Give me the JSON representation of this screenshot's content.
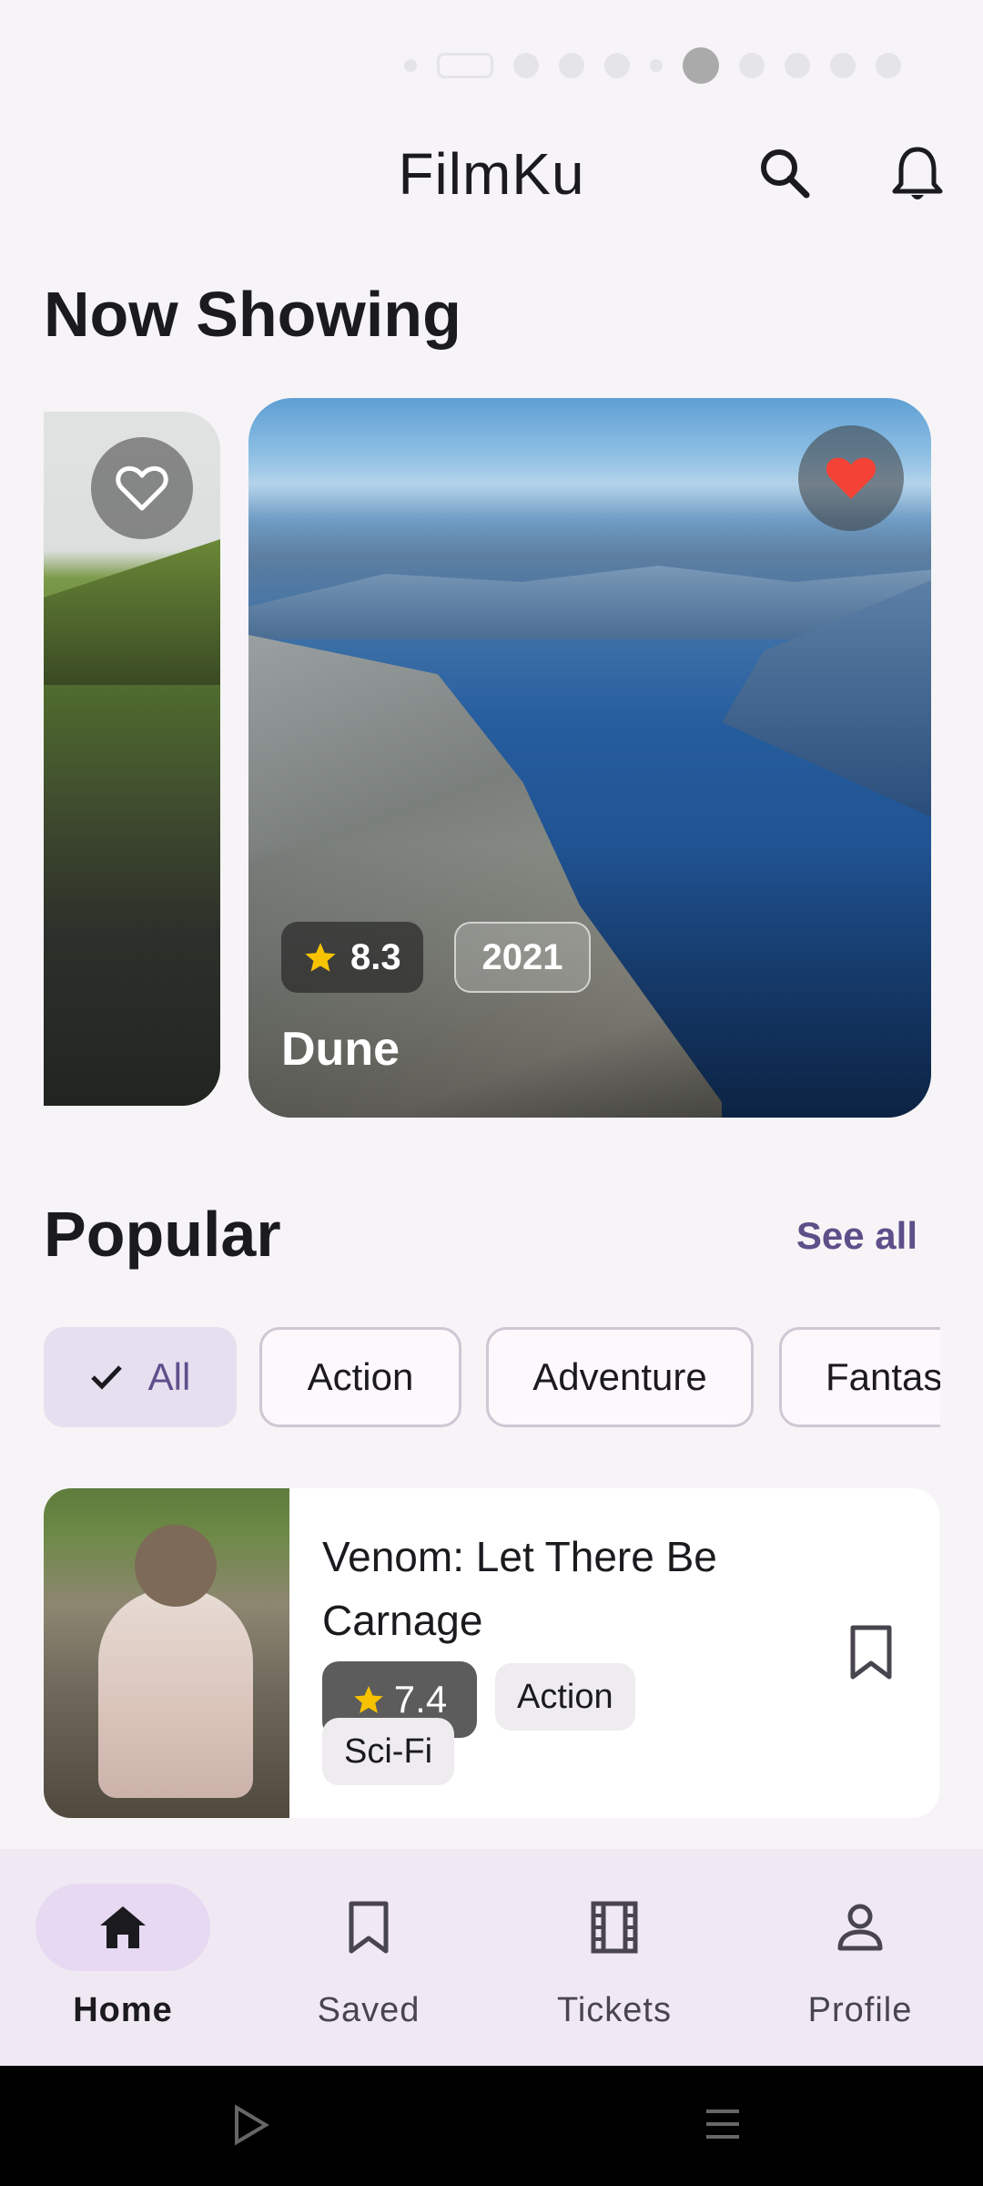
{
  "app": {
    "title": "FilmKu"
  },
  "sections": {
    "now_showing": "Now Showing",
    "popular": "Popular",
    "see_all": "See all"
  },
  "now_showing": {
    "featured": {
      "title": "Dune",
      "rating": "8.3",
      "year": "2021",
      "favorited": true
    }
  },
  "filters": [
    {
      "label": "All",
      "selected": true
    },
    {
      "label": "Action",
      "selected": false
    },
    {
      "label": "Adventure",
      "selected": false
    },
    {
      "label": "Fantas",
      "selected": false
    }
  ],
  "popular_list": [
    {
      "title": "Venom: Let There Be Carnage",
      "rating": "7.4",
      "tags": [
        "Action",
        "Sci-Fi"
      ]
    }
  ],
  "bottom_nav": [
    {
      "label": "Home",
      "icon": "home-icon",
      "active": true
    },
    {
      "label": "Saved",
      "icon": "bookmark-icon",
      "active": false
    },
    {
      "label": "Tickets",
      "icon": "film-icon",
      "active": false
    },
    {
      "label": "Profile",
      "icon": "person-icon",
      "active": false
    }
  ],
  "colors": {
    "accent": "#5e4f8a",
    "favorite": "#f44336",
    "star": "#f7c300"
  }
}
